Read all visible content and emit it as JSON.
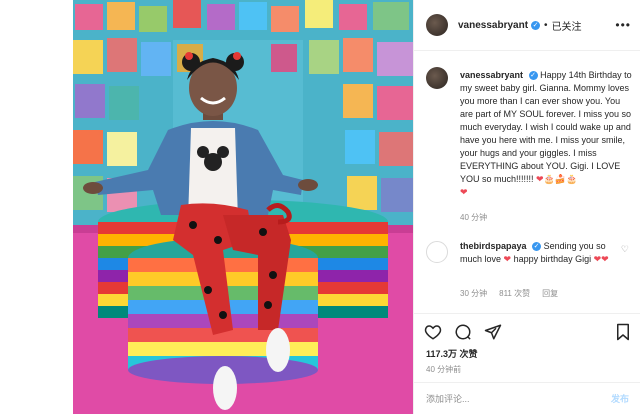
{
  "post": {
    "image_alt": "Girl sitting on colorful striped platform in front of papel picado wall"
  },
  "header": {
    "username": "vanessabryant",
    "verified_mark": "✓",
    "separator": "•",
    "follow_label": "已关注",
    "more_icon": "more-icon"
  },
  "caption": {
    "username": "vanessabryant",
    "verified_mark": "✓",
    "text": "Happy 14th Birthday to my sweet baby girl. Gianna. Mommy loves you more than I can ever show you. You are part of MY SOUL forever. I miss you so much everyday. I wish I could wake up and have you here with me. I miss your smile, your hugs and your giggles. I miss EVERYTHING about YOU. Gigi. I LOVE YOU so much!!!!!!! ",
    "emojis": [
      "❤",
      "🎂",
      "🍰",
      "🎂",
      "❤"
    ],
    "time": "40 分钟"
  },
  "comment": {
    "username": "thebirdspapaya",
    "verified_mark": "✓",
    "text_before": "Sending you so much love ",
    "heart": "❤",
    "text_after": " happy birthday Gigi ",
    "hearts_end": "❤❤",
    "time": "30 分钟",
    "likes": "811 次赞",
    "reply": "回复",
    "like_icon": "heart-outline-icon"
  },
  "actions": {
    "likes_count": "117.3万 次赞",
    "post_time": "40 分钟前"
  },
  "compose": {
    "placeholder": "添加评论...",
    "post_label": "发布"
  },
  "colors": {
    "verified": "#3897f0",
    "meta_gray": "#8e8e8e",
    "post_button_disabled": "#b3dbff",
    "heart_red": "#ed4956"
  }
}
